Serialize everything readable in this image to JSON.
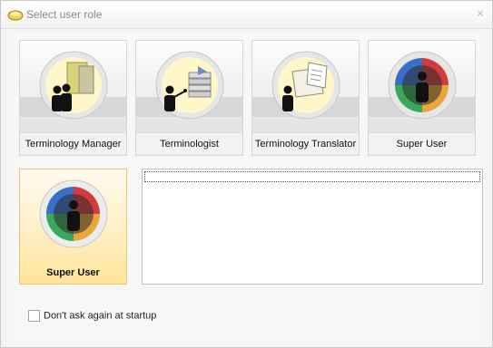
{
  "window": {
    "title": "Select user role",
    "close_glyph": "×"
  },
  "roles": [
    {
      "label": "Terminology Manager",
      "icon": "terminology-manager-icon",
      "selected": false
    },
    {
      "label": "Terminologist",
      "icon": "terminologist-icon",
      "selected": false
    },
    {
      "label": "Terminology Translator",
      "icon": "terminology-translator-icon",
      "selected": false
    },
    {
      "label": "Super User",
      "icon": "super-user-icon",
      "selected": false
    }
  ],
  "selected_role": {
    "label": "Super User",
    "icon": "super-user-icon"
  },
  "description": "",
  "startup": {
    "label": "Don't ask again at startup",
    "checked": false
  },
  "colors": {
    "selected_bg": "#ffe49a",
    "border": "#b7c3d0",
    "title_text": "#8a8a8a"
  }
}
